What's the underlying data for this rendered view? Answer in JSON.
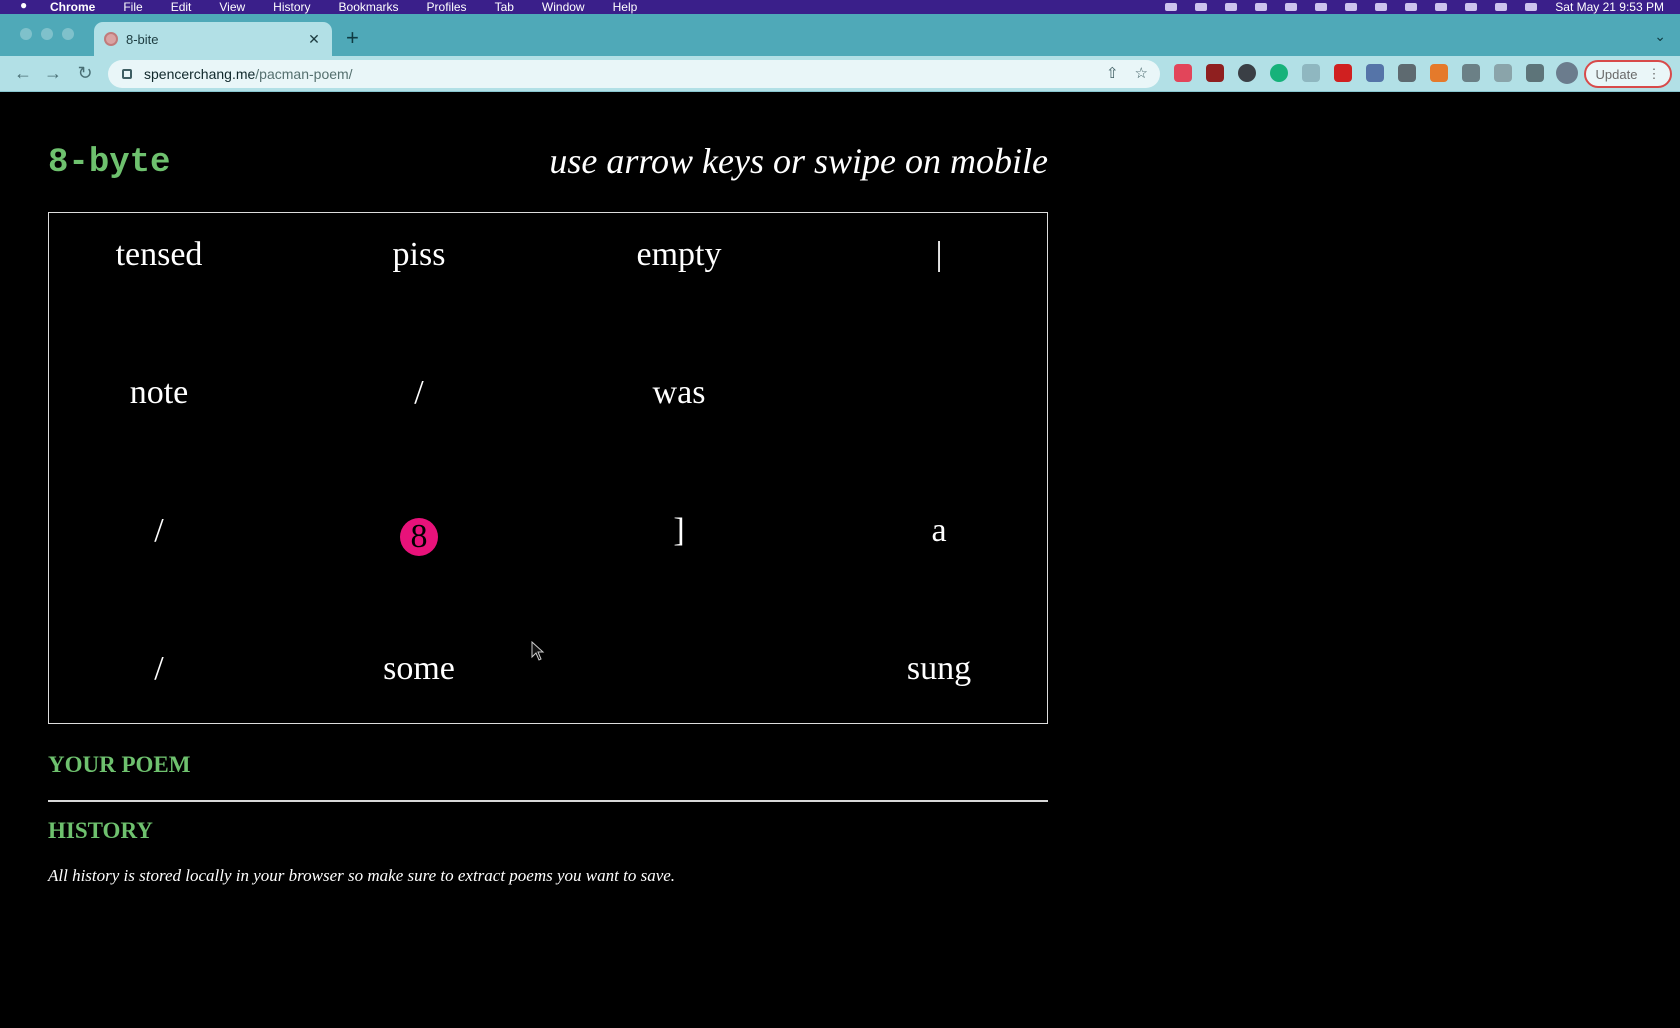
{
  "menubar": {
    "items": [
      "Chrome",
      "File",
      "Edit",
      "View",
      "History",
      "Bookmarks",
      "Profiles",
      "Tab",
      "Window",
      "Help"
    ],
    "clock": "Sat May 21 9:53 PM"
  },
  "browser": {
    "tab_title": "8-bite",
    "url_host": "spencerchang.me",
    "url_path": "/pacman-poem/",
    "update_label": "Update"
  },
  "page": {
    "logo_num": "8",
    "logo_word": "byte",
    "hint": "use arrow keys or swipe on mobile",
    "grid": [
      [
        "tensed",
        "piss",
        "empty",
        "|"
      ],
      [
        "note",
        "/",
        "was",
        ""
      ],
      [
        "/",
        "",
        "]",
        "a"
      ],
      [
        "/",
        "some",
        "",
        "sung"
      ]
    ],
    "player": {
      "symbol": "8",
      "row": 3,
      "col": 2,
      "color": "#e8127a"
    },
    "your_poem_title": "YOUR POEM",
    "history_title": "HISTORY",
    "history_note": "All history is stored locally in your browser so make sure to extract poems you want to save.",
    "accent_color": "#6ec16e"
  }
}
